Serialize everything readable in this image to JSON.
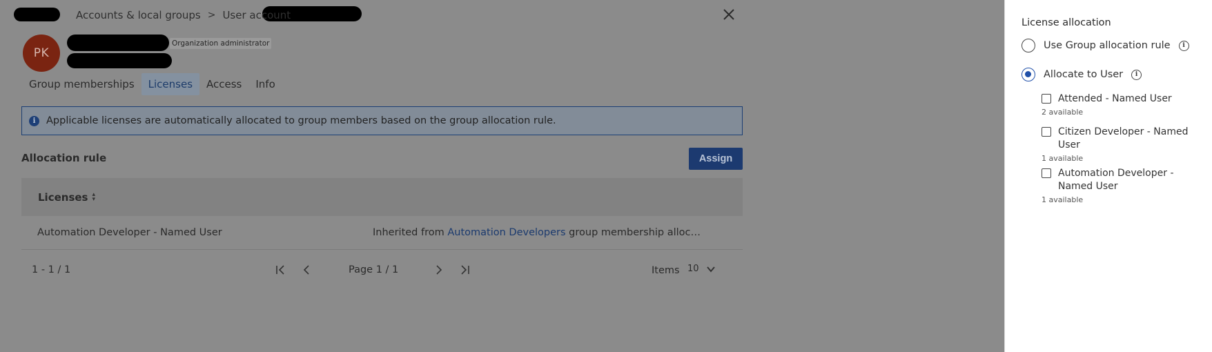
{
  "breadcrumb": {
    "items": [
      "Accounts & local groups",
      "User account"
    ],
    "separator": ">"
  },
  "user": {
    "initials": "PK",
    "role": "Organization administrator"
  },
  "tabs": [
    {
      "label": "Group memberships"
    },
    {
      "label": "Licenses",
      "active": true
    },
    {
      "label": "Access"
    },
    {
      "label": "Info"
    }
  ],
  "info_banner": {
    "text": "Applicable licenses are automatically allocated to group members based on the group allocation rule."
  },
  "allocation": {
    "title": "Allocation rule",
    "assign_label": "Assign"
  },
  "table": {
    "column_header": "Licenses",
    "rows": [
      {
        "license": "Automation Developer - Named User",
        "inherit_prefix": "Inherited from ",
        "inherit_link": "Automation Developers",
        "inherit_suffix": " group membership allocation r..."
      }
    ]
  },
  "pager": {
    "range": "1 - 1 / 1",
    "page_label": "Page 1 / 1",
    "items_label": "Items",
    "items_value": "10"
  },
  "panel": {
    "title": "License allocation",
    "options": [
      {
        "label": "Use Group allocation rule",
        "checked": false
      },
      {
        "label": "Allocate to User",
        "checked": true
      }
    ],
    "licenses": [
      {
        "label": "Attended - Named User",
        "availability": "2 available"
      },
      {
        "label": "Citizen Developer - Named User",
        "availability": "1 available"
      },
      {
        "label": "Automation Developer - Named User",
        "availability": "1 available"
      }
    ]
  },
  "colors": {
    "accent": "#1f4fa8",
    "avatar": "#a93318",
    "overlay_dim": "#8b8b8b"
  }
}
